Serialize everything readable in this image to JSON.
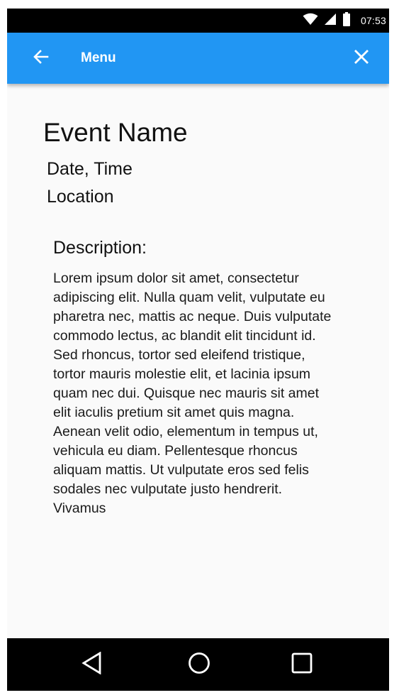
{
  "status_bar": {
    "time": "07:53",
    "icons": [
      "wifi-icon",
      "signal-icon",
      "battery-icon"
    ]
  },
  "app_bar": {
    "title": "Menu",
    "back_icon": "arrow-back-icon",
    "close_icon": "close-icon",
    "color": "#2196f3"
  },
  "event": {
    "name": "Event Name",
    "date_time": "Date, Time",
    "location": "Location",
    "description_label": "Description:",
    "description": "Lorem ipsum dolor sit amet, consectetur adipiscing elit. Nulla quam velit, vulputate eu pharetra nec, mattis ac neque. Duis vulputate commodo lectus, ac blandit elit tincidunt id. Sed rhoncus, tortor sed eleifend tristique, tortor mauris molestie elit, et lacinia ipsum quam nec dui. Quisque nec mauris sit amet elit iaculis pretium sit amet quis magna. Aenean velit odio, elementum in tempus ut, vehicula eu diam. Pellentesque rhoncus aliquam mattis. Ut vulputate eros sed felis sodales nec vulputate justo hendrerit. Vivamus"
  },
  "nav_bar": {
    "buttons": [
      "back-triangle-icon",
      "home-circle-icon",
      "recents-square-icon"
    ]
  }
}
